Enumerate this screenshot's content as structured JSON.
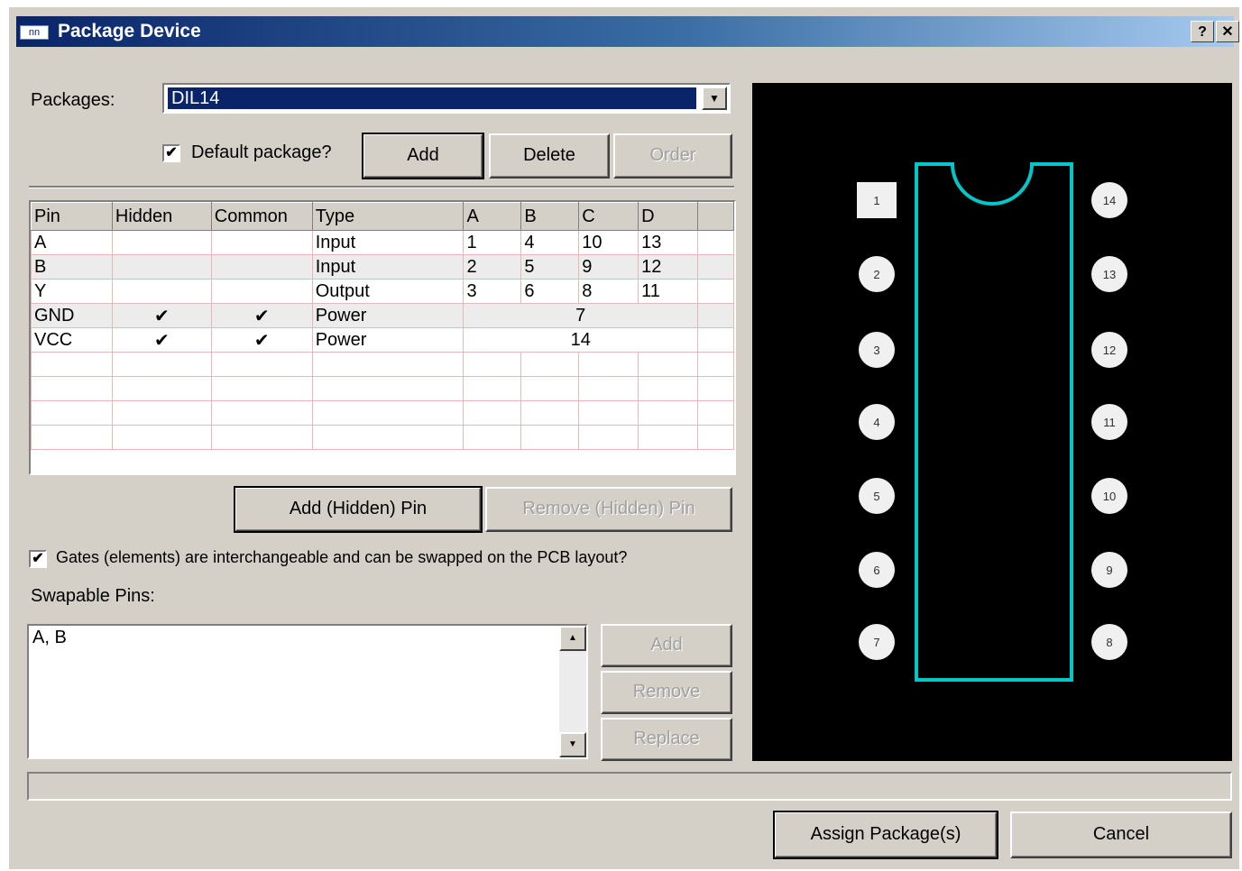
{
  "window": {
    "title": "Package Device",
    "help_label": "?",
    "close_label": "✕",
    "icon_text": "nn"
  },
  "packages": {
    "label": "Packages:",
    "selected": "DIL14",
    "dropdown_arrow": "▼"
  },
  "default_package": {
    "label": "Default package?",
    "checked": "✔"
  },
  "package_buttons": {
    "add": "Add",
    "delete": "Delete",
    "order": "Order"
  },
  "pin_table": {
    "headers": [
      "Pin",
      "Hidden",
      "Common",
      "Type",
      "A",
      "B",
      "C",
      "D"
    ],
    "rows": [
      {
        "pin": "A",
        "hidden": "",
        "common": "",
        "type": "Input",
        "a": "1",
        "b": "4",
        "c": "10",
        "d": "13"
      },
      {
        "pin": "B",
        "hidden": "",
        "common": "",
        "type": "Input",
        "a": "2",
        "b": "5",
        "c": "9",
        "d": "12"
      },
      {
        "pin": "Y",
        "hidden": "",
        "common": "",
        "type": "Output",
        "a": "3",
        "b": "6",
        "c": "8",
        "d": "11"
      },
      {
        "pin": "GND",
        "hidden": "✔",
        "common": "✔",
        "type": "Power",
        "merged": "7"
      },
      {
        "pin": "VCC",
        "hidden": "✔",
        "common": "✔",
        "type": "Power",
        "merged": "14"
      }
    ]
  },
  "pin_buttons": {
    "add_hidden": "Add (Hidden) Pin",
    "remove_hidden": "Remove (Hidden) Pin"
  },
  "gates": {
    "label": "Gates (elements) are interchangeable and can be swapped on the PCB layout?",
    "checked": "✔"
  },
  "swappable": {
    "label": "Swapable Pins:",
    "value": "A, B",
    "add": "Add",
    "remove": "Remove",
    "replace": "Replace"
  },
  "footprint": {
    "pins_left": [
      "1",
      "2",
      "3",
      "4",
      "5",
      "6",
      "7"
    ],
    "pins_right": [
      "14",
      "13",
      "12",
      "11",
      "10",
      "9",
      "8"
    ],
    "outline_color": "#00c8c8"
  },
  "footer": {
    "assign": "Assign Package(s)",
    "cancel": "Cancel"
  }
}
